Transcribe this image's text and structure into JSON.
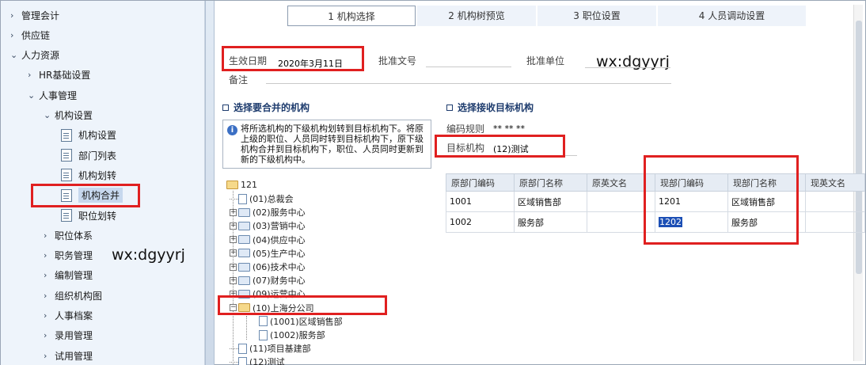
{
  "nav": {
    "items": [
      {
        "label": "管理会计",
        "chev": "›",
        "indent": 0
      },
      {
        "label": "供应链",
        "chev": "›",
        "indent": 0
      },
      {
        "label": "人力资源",
        "chev": "⌄",
        "indent": 0
      },
      {
        "label": "HR基础设置",
        "chev": "›",
        "indent": 1
      },
      {
        "label": "人事管理",
        "chev": "⌄",
        "indent": 1
      },
      {
        "label": "机构设置",
        "chev": "⌄",
        "indent": 2
      },
      {
        "label": "机构设置",
        "doc": true,
        "indent": 3
      },
      {
        "label": "部门列表",
        "doc": true,
        "indent": 3
      },
      {
        "label": "机构划转",
        "doc": true,
        "indent": 3
      },
      {
        "label": "机构合并",
        "doc": true,
        "indent": 3,
        "active": true
      },
      {
        "label": "职位划转",
        "doc": true,
        "indent": 3
      },
      {
        "label": "职位体系",
        "chev": "›",
        "indent": 2
      },
      {
        "label": "职务管理",
        "chev": "›",
        "indent": 2
      },
      {
        "label": "编制管理",
        "chev": "›",
        "indent": 2
      },
      {
        "label": "组织机构图",
        "chev": "›",
        "indent": 2
      },
      {
        "label": "人事档案",
        "chev": "›",
        "indent": 2
      },
      {
        "label": "录用管理",
        "chev": "›",
        "indent": 2
      },
      {
        "label": "试用管理",
        "chev": "›",
        "indent": 2
      }
    ]
  },
  "watermark": "wx:dgyyrj",
  "steps": [
    {
      "label": "1 机构选择",
      "active": true
    },
    {
      "label": "2 机构树预览"
    },
    {
      "label": "3 职位设置"
    },
    {
      "label": "4 人员调动设置"
    }
  ],
  "form": {
    "effective_date_label": "生效日期",
    "effective_date_value": "2020年3月11日",
    "approval_doc_label": "批准文号",
    "approval_unit_label": "批准单位",
    "remark_label": "备注"
  },
  "left_section": {
    "title": "选择要合并的机构",
    "info": "将所选机构的下级机构划转到目标机构下。将原上级的职位、人员同时转到目标机构下，原下级机构合并到目标机构下，职位、人员同时更新到新的下级机构中。"
  },
  "right_section": {
    "title": "选择接收目标机构",
    "code_rule_label": "编码规则",
    "code_rule_value": "** ** **",
    "target_label": "目标机构",
    "target_value": "(12)测试"
  },
  "tree": {
    "root": "121",
    "nodes": [
      {
        "label": "(01)总裁会",
        "type": "doc"
      },
      {
        "label": "(02)服务中心",
        "type": "folder"
      },
      {
        "label": "(03)营销中心",
        "type": "folder"
      },
      {
        "label": "(04)供应中心",
        "type": "folder"
      },
      {
        "label": "(05)生产中心",
        "type": "folder"
      },
      {
        "label": "(06)技术中心",
        "type": "folder"
      },
      {
        "label": "(07)财务中心",
        "type": "folder"
      },
      {
        "label": "(09)运营中心",
        "type": "folder"
      },
      {
        "label": "(10)上海分公司",
        "type": "folder-open"
      },
      {
        "label": "(1001)区域销售部",
        "type": "doc",
        "child": true
      },
      {
        "label": "(1002)服务部",
        "type": "doc",
        "child": true
      },
      {
        "label": "(11)项目基建部",
        "type": "doc"
      },
      {
        "label": "(12)测试",
        "type": "doc"
      }
    ]
  },
  "grid": {
    "headers": [
      "原部门编码",
      "原部门名称",
      "原英文名",
      "现部门编码",
      "现部门名称",
      "现英文名"
    ],
    "rows": [
      [
        "1001",
        "区域销售部",
        "",
        "1201",
        "区域销售部",
        ""
      ],
      [
        "1002",
        "服务部",
        "",
        "1202",
        "服务部",
        ""
      ]
    ]
  },
  "colors": {
    "highlight": "#e02020",
    "accent": "#1e3c6e",
    "selection": "#1c4fb5"
  }
}
